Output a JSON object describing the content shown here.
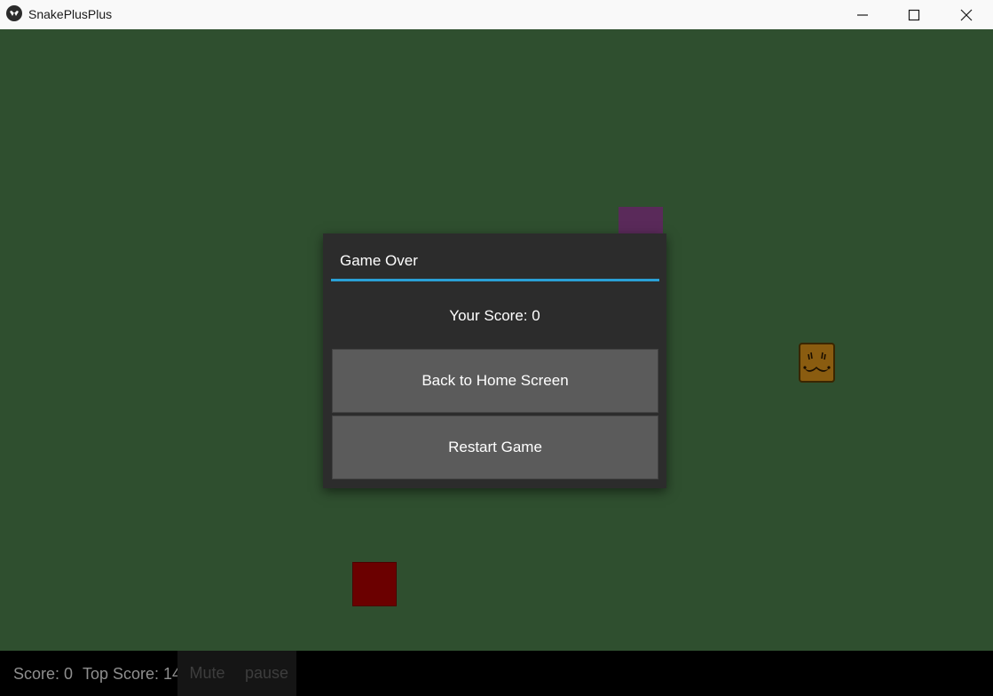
{
  "window": {
    "title": "SnakePlusPlus",
    "icon": "kivy-icon",
    "controls": [
      "minimize-icon",
      "maximize-icon",
      "close-icon"
    ]
  },
  "game": {
    "background_color": "#2f4f2f",
    "objects": [
      {
        "name": "purple-block",
        "color": "#5a2a5a"
      },
      {
        "name": "red-food-block",
        "color": "#6b0000"
      },
      {
        "name": "mustache-face-powerup",
        "color": "#8a5c10"
      }
    ]
  },
  "dialog": {
    "title": "Game Over",
    "accent_color": "#2aa0d6",
    "score_text": "Your Score: 0",
    "buttons": {
      "home": "Back to Home Screen",
      "restart": "Restart Game"
    }
  },
  "bottom_bar": {
    "score": "Score: 0",
    "top_score": "Top Score: 14",
    "mute": "Mute",
    "pause": "pause"
  }
}
